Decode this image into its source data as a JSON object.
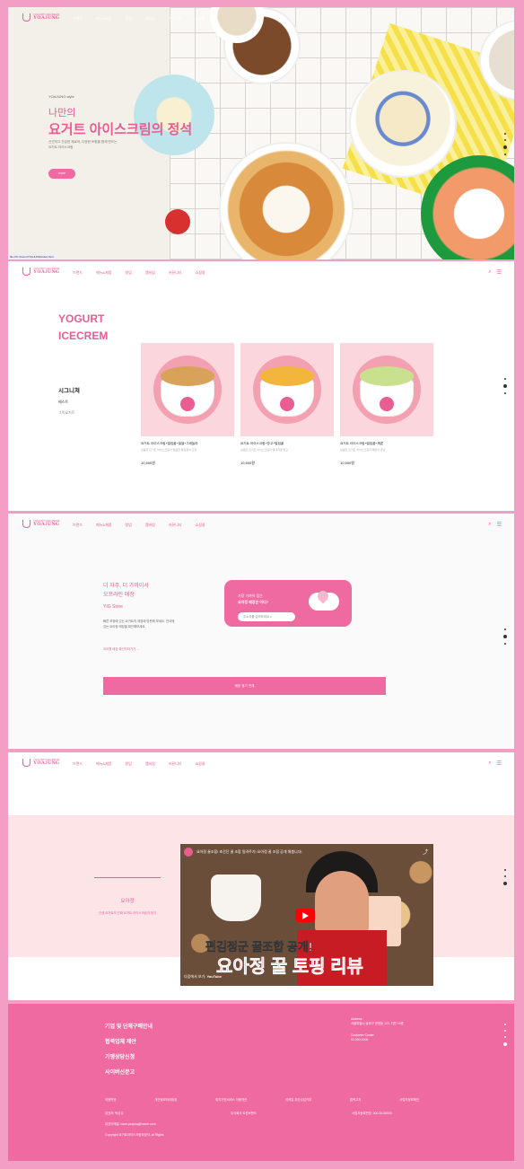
{
  "nav": {
    "logo_small": "YOGURT ICECREAM",
    "logo_main": "YOAJUNG",
    "menu": [
      "브랜드",
      "메뉴&제품",
      "창업",
      "멤버십",
      "커뮤니티",
      "쇼핑몰"
    ],
    "menu2": [
      "브랜드",
      "메뉴&제품",
      "창업",
      "멤버십",
      "커뮤니티",
      "쇼핑몰"
    ]
  },
  "hero": {
    "tagline": "YOAJUNG style",
    "title1": "나만의",
    "title2": "요거트 아이스크림의 정석",
    "desc": "신선하고 건강한 재료와, 다양한 토핑을 함께 만드는 요거트 아이스크림",
    "button": "more",
    "status_url": "file:///C:/Users/YOAJUNG/index.html"
  },
  "signature": {
    "heading_line1": "YOGURT",
    "heading_line2": "ICECREM",
    "category_title": "시그니쳐",
    "cat_best": "베스트",
    "cat_greek": "그릭요거트",
    "products": [
      {
        "name": "요거트 아이스크림+벌집꿀+밀셀+그래놀라",
        "desc": "상큼한 요거트 아이스크림과 달콤한 벌집꿀의 조합",
        "price": "10,500원",
        "topping": "#d9a25a"
      },
      {
        "name": "요거트 아이스크림+망고+벌집꿀",
        "desc": "상큼한 요거트 아이스크림과 열대과일 망고",
        "price": "10,500원",
        "topping": "#f2b63c"
      },
      {
        "name": "요거트 아이스크림+벌집꿀+메론",
        "desc": "상큼한 요거트 아이스크림과 메론의 만남",
        "price": "10,500원",
        "topping": "#c9e08f"
      }
    ]
  },
  "store": {
    "heading1": "더 자주, 더 가까이서",
    "heading2": "오프라인 매장",
    "brand": "YIG Store",
    "desc": "빠른 포장에 있는 요거트의 매장에 방문해 보세요. 전국에 있는 요아정 매장을 확인해보세요.",
    "link": "요아정 매장 확인하러가기",
    "box_q1": "가장 가까이 있는",
    "box_q2": "요아정 매장은 어디?",
    "search_placeholder": "주소지를 입력하세요",
    "big_button": "매장 찾기 전체"
  },
  "review": {
    "title": "요아정",
    "desc": "인생 요거트의 진짜 요거트 아이스크림의 정석",
    "video_title": "요아정 꿀조합! 초간단 꿀 조합 알려주기! 요아정 꿀 조합 공개 해봅니다!",
    "caption1": "편김정군 꿀조합 공개!",
    "caption2": "요아정 꿀 토핑 리뷰",
    "watch_on": "다음에서 보기:",
    "youtube": "YouTube"
  },
  "footer": {
    "links_main": [
      "기업 및 단체구매안내",
      "협력업체 제안",
      "가맹상담신청",
      "사이버신문고"
    ],
    "addr_label": "Address",
    "addr": "서울특별시 송파구 문정동 123, 지번 15층",
    "cs_label": "Customer Center",
    "cs": "02-000-0000",
    "bottom_links": [
      "이용약관",
      "개인정보처리방침",
      "위치기반서비스 이용약관",
      "이메일 무단수집거부",
      "법적고지",
      "사업자정보확인"
    ],
    "ceo": "대표자: 박은주",
    "biz_reg": "사업자등록번호: 000-00-00000",
    "company": "주식회사 트윈브랜드",
    "email": "대표이메일: www.yoajung@naver.com",
    "copyright": "Copyright 요거트아이스크림의정석. all Rights"
  }
}
